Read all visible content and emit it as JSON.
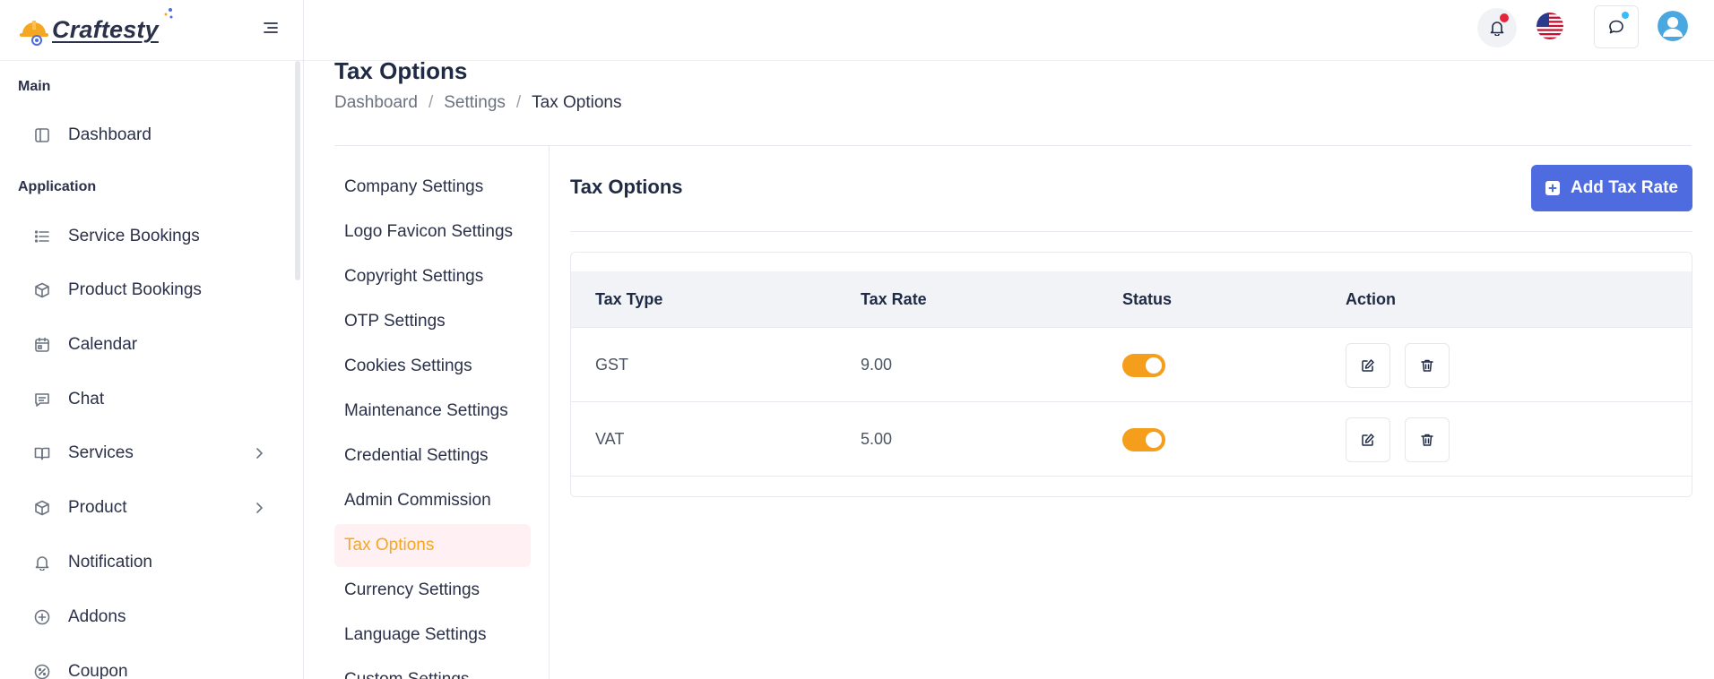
{
  "brand": {
    "name": "Craftesty"
  },
  "sidebar": {
    "sections": [
      {
        "title": "Main"
      },
      {
        "title": "Application"
      }
    ],
    "items": [
      {
        "label": "Dashboard",
        "icon": "layout-icon"
      },
      {
        "label": "Service Bookings",
        "icon": "list-icon"
      },
      {
        "label": "Product Bookings",
        "icon": "box-icon"
      },
      {
        "label": "Calendar",
        "icon": "calendar-icon"
      },
      {
        "label": "Chat",
        "icon": "message-icon"
      },
      {
        "label": "Services",
        "icon": "book-icon",
        "has_children": true
      },
      {
        "label": "Product",
        "icon": "box-icon",
        "has_children": true
      },
      {
        "label": "Notification",
        "icon": "bell-icon"
      },
      {
        "label": "Addons",
        "icon": "plus-circle-icon"
      },
      {
        "label": "Coupon",
        "icon": "percent-icon"
      }
    ]
  },
  "header": {
    "icons": [
      "bell-icon",
      "us-flag-icon",
      "chat-icon",
      "user-avatar-icon"
    ],
    "colors": {
      "notification_dot": "#e5243b",
      "chat_dot": "#38bdf8"
    }
  },
  "page": {
    "title": "Tax Options",
    "breadcrumb": [
      "Dashboard",
      "Settings",
      "Tax Options"
    ],
    "breadcrumb_separator": "/"
  },
  "settings_menu": {
    "items": [
      "Company Settings",
      "Logo Favicon Settings",
      "Copyright Settings",
      "OTP Settings",
      "Cookies Settings",
      "Maintenance Settings",
      "Credential Settings",
      "Admin Commission",
      "Tax Options",
      "Currency Settings",
      "Language Settings",
      "Custom Settings"
    ],
    "active": "Tax Options"
  },
  "content": {
    "title": "Tax Options",
    "add_button_label": "Add Tax Rate",
    "table": {
      "columns": [
        "Tax Type",
        "Tax Rate",
        "Status",
        "Action"
      ],
      "rows": [
        {
          "tax_type": "GST",
          "tax_rate": "9.00",
          "status": true
        },
        {
          "tax_type": "VAT",
          "tax_rate": "5.00",
          "status": true
        }
      ]
    }
  },
  "colors": {
    "primary": "#4f6be0",
    "accent": "#f5a623",
    "toggle_on": "#f59e1b",
    "active_menu_bg": "#fff1f3"
  }
}
